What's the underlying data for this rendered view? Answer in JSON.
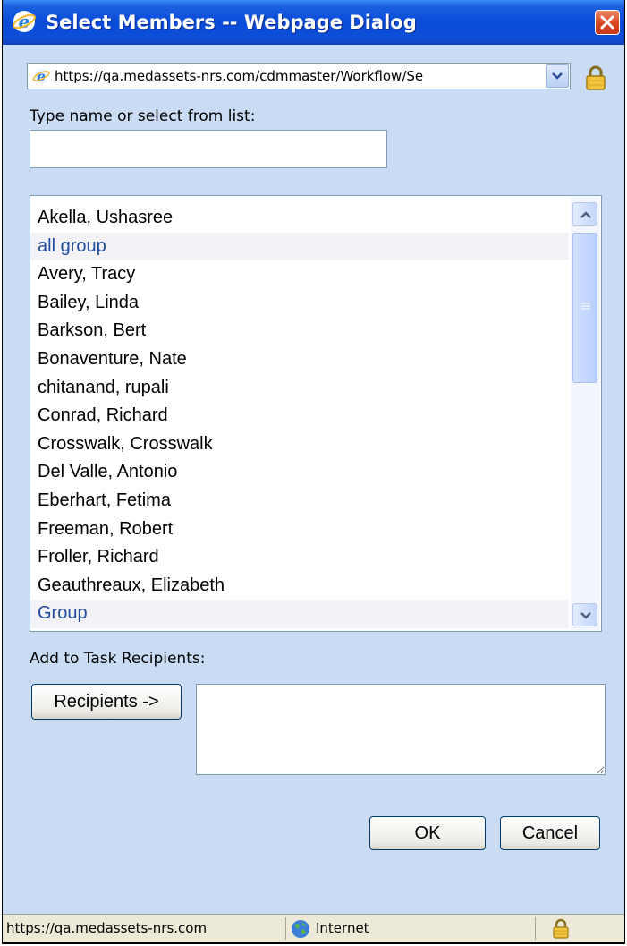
{
  "window": {
    "title": "Select Members -- Webpage Dialog",
    "address": "https://qa.medassets-nrs.com/cdmmaster/Workflow/Se"
  },
  "form": {
    "search_label": "Type name or select from list:",
    "search_value": "",
    "members": [
      {
        "name": "Akella, Ushasree",
        "kind": "user"
      },
      {
        "name": "all group",
        "kind": "group"
      },
      {
        "name": "Avery, Tracy",
        "kind": "user"
      },
      {
        "name": "Bailey, Linda",
        "kind": "user"
      },
      {
        "name": "Barkson, Bert",
        "kind": "user"
      },
      {
        "name": "Bonaventure, Nate",
        "kind": "user"
      },
      {
        "name": "chitanand, rupali",
        "kind": "user"
      },
      {
        "name": "Conrad, Richard",
        "kind": "user"
      },
      {
        "name": "Crosswalk, Crosswalk",
        "kind": "user"
      },
      {
        "name": "Del Valle, Antonio",
        "kind": "user"
      },
      {
        "name": "Eberhart, Fetima",
        "kind": "user"
      },
      {
        "name": "Freeman, Robert",
        "kind": "user"
      },
      {
        "name": "Froller, Richard",
        "kind": "user"
      },
      {
        "name": "Geauthreaux, Elizabeth",
        "kind": "user"
      },
      {
        "name": "Group",
        "kind": "group"
      }
    ],
    "recipients_label": "Add to Task Recipients:",
    "recipients_button": "Recipients ->",
    "recipients_value": "",
    "ok_label": "OK",
    "cancel_label": "Cancel"
  },
  "status": {
    "url": "https://qa.medassets-nrs.com",
    "zone": "Internet"
  },
  "colors": {
    "titlebar": "#0a4bd8",
    "dialog_bg": "#c9dcf4",
    "group_text": "#1f4c9c",
    "close_button": "#d9461e"
  },
  "icons": [
    "ie-icon",
    "close-icon",
    "chevron-down-icon",
    "lock-icon",
    "chevron-up-icon",
    "globe-icon"
  ]
}
